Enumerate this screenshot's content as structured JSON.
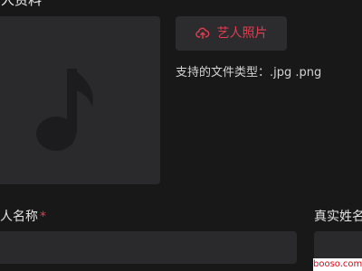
{
  "section": {
    "title": "艺人资料"
  },
  "cover": {
    "icon": "music-note-icon"
  },
  "upload": {
    "icon": "cloud-upload-icon",
    "label": "艺人照片",
    "hint": "支持的文件类型：.jpg .png"
  },
  "fields": {
    "artist_name": {
      "label": "艺人名称",
      "required": "*",
      "value": "",
      "placeholder": ""
    },
    "real_name": {
      "label": "真实姓名",
      "value": "",
      "placeholder": ""
    }
  },
  "watermark": "booso.com",
  "colors": {
    "background": "#181819",
    "panel": "#2a2a2c",
    "accent": "#e23d50"
  }
}
